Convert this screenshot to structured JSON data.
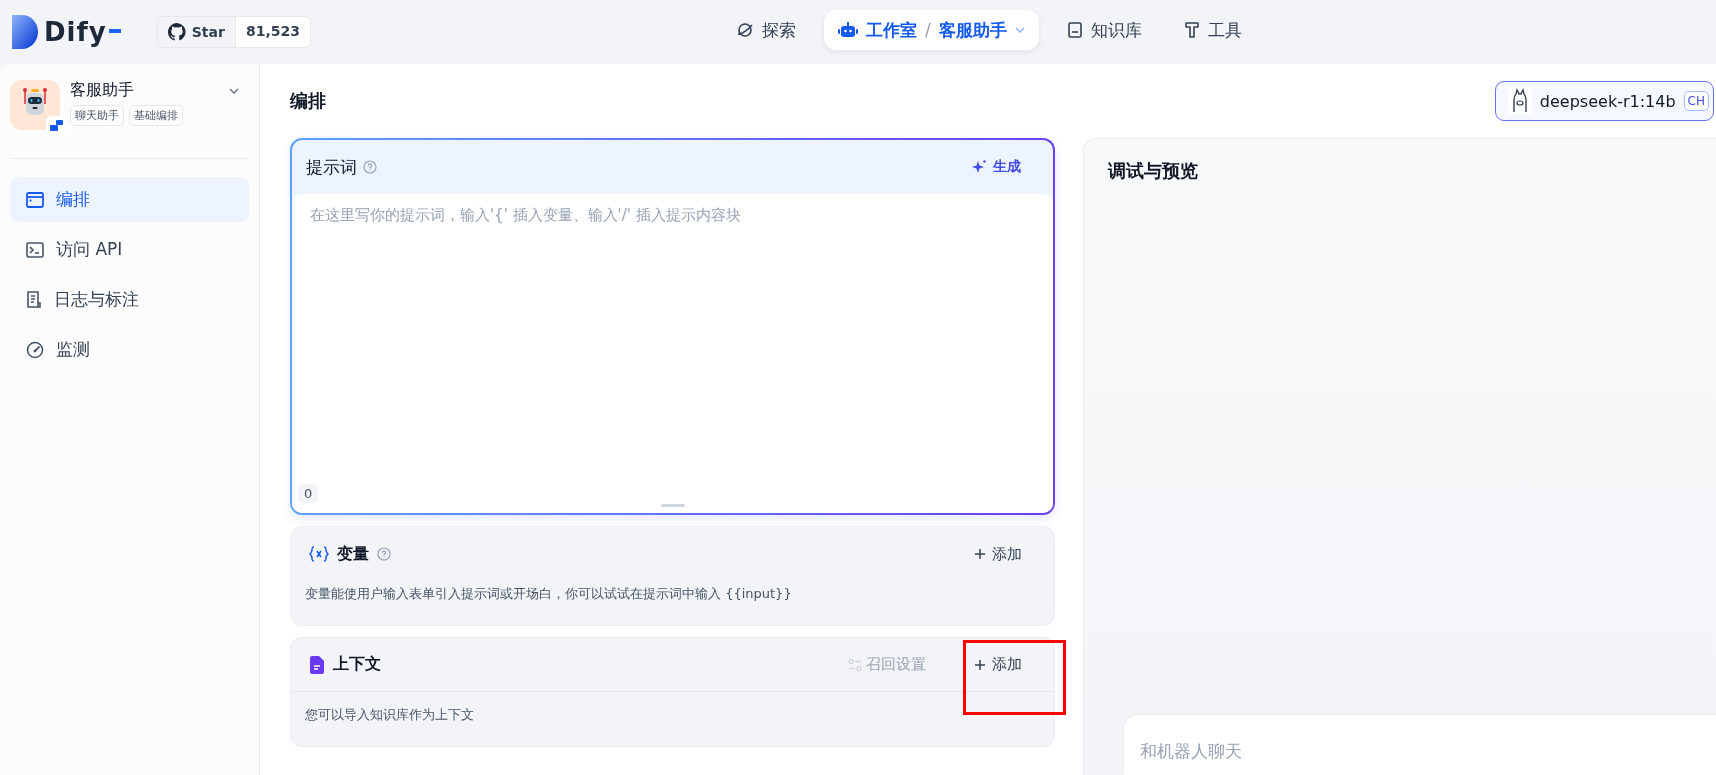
{
  "header": {
    "logo": "Dify",
    "github": {
      "label": "Star",
      "count": "81,523"
    },
    "nav": [
      {
        "kind": "link",
        "label": "探索",
        "selected": false
      },
      {
        "kind": "breadcrumb",
        "label": "工作室",
        "separator": "/",
        "current": "客服助手",
        "selected": true
      },
      {
        "kind": "link",
        "label": "知识库",
        "selected": false
      },
      {
        "kind": "link",
        "label": "工具",
        "selected": false
      }
    ]
  },
  "sidebar": {
    "app": {
      "name": "客服助手",
      "tags": [
        "聊天助手",
        "基础编排"
      ]
    },
    "items": [
      {
        "label": "编排",
        "selected": true
      },
      {
        "label": "访问 API",
        "selected": false
      },
      {
        "label": "日志与标注",
        "selected": false
      },
      {
        "label": "监测",
        "selected": false
      }
    ]
  },
  "main": {
    "title": "编排",
    "model": {
      "name": "deepseek-r1:14b",
      "badge": "CH"
    },
    "prompt": {
      "title": "提示词",
      "generate": "生成",
      "placeholder": "在这里写你的提示词，输入'{' 插入变量、输入'/' 插入提示内容块",
      "count": "0"
    },
    "sections": [
      {
        "kind": "variables",
        "title": "变量",
        "help": true,
        "description": "变量能使用户输入表单引入提示词或开场白，你可以试试在提示词中输入 {{input}}",
        "add": "添加",
        "highlighted": false
      },
      {
        "kind": "context",
        "title": "上下文",
        "help": false,
        "settings": "召回设置",
        "description": "您可以导入知识库作为上下文",
        "add": "添加",
        "highlighted": true
      }
    ]
  },
  "preview": {
    "title": "调试与预览",
    "input_placeholder": "和机器人聊天"
  }
}
